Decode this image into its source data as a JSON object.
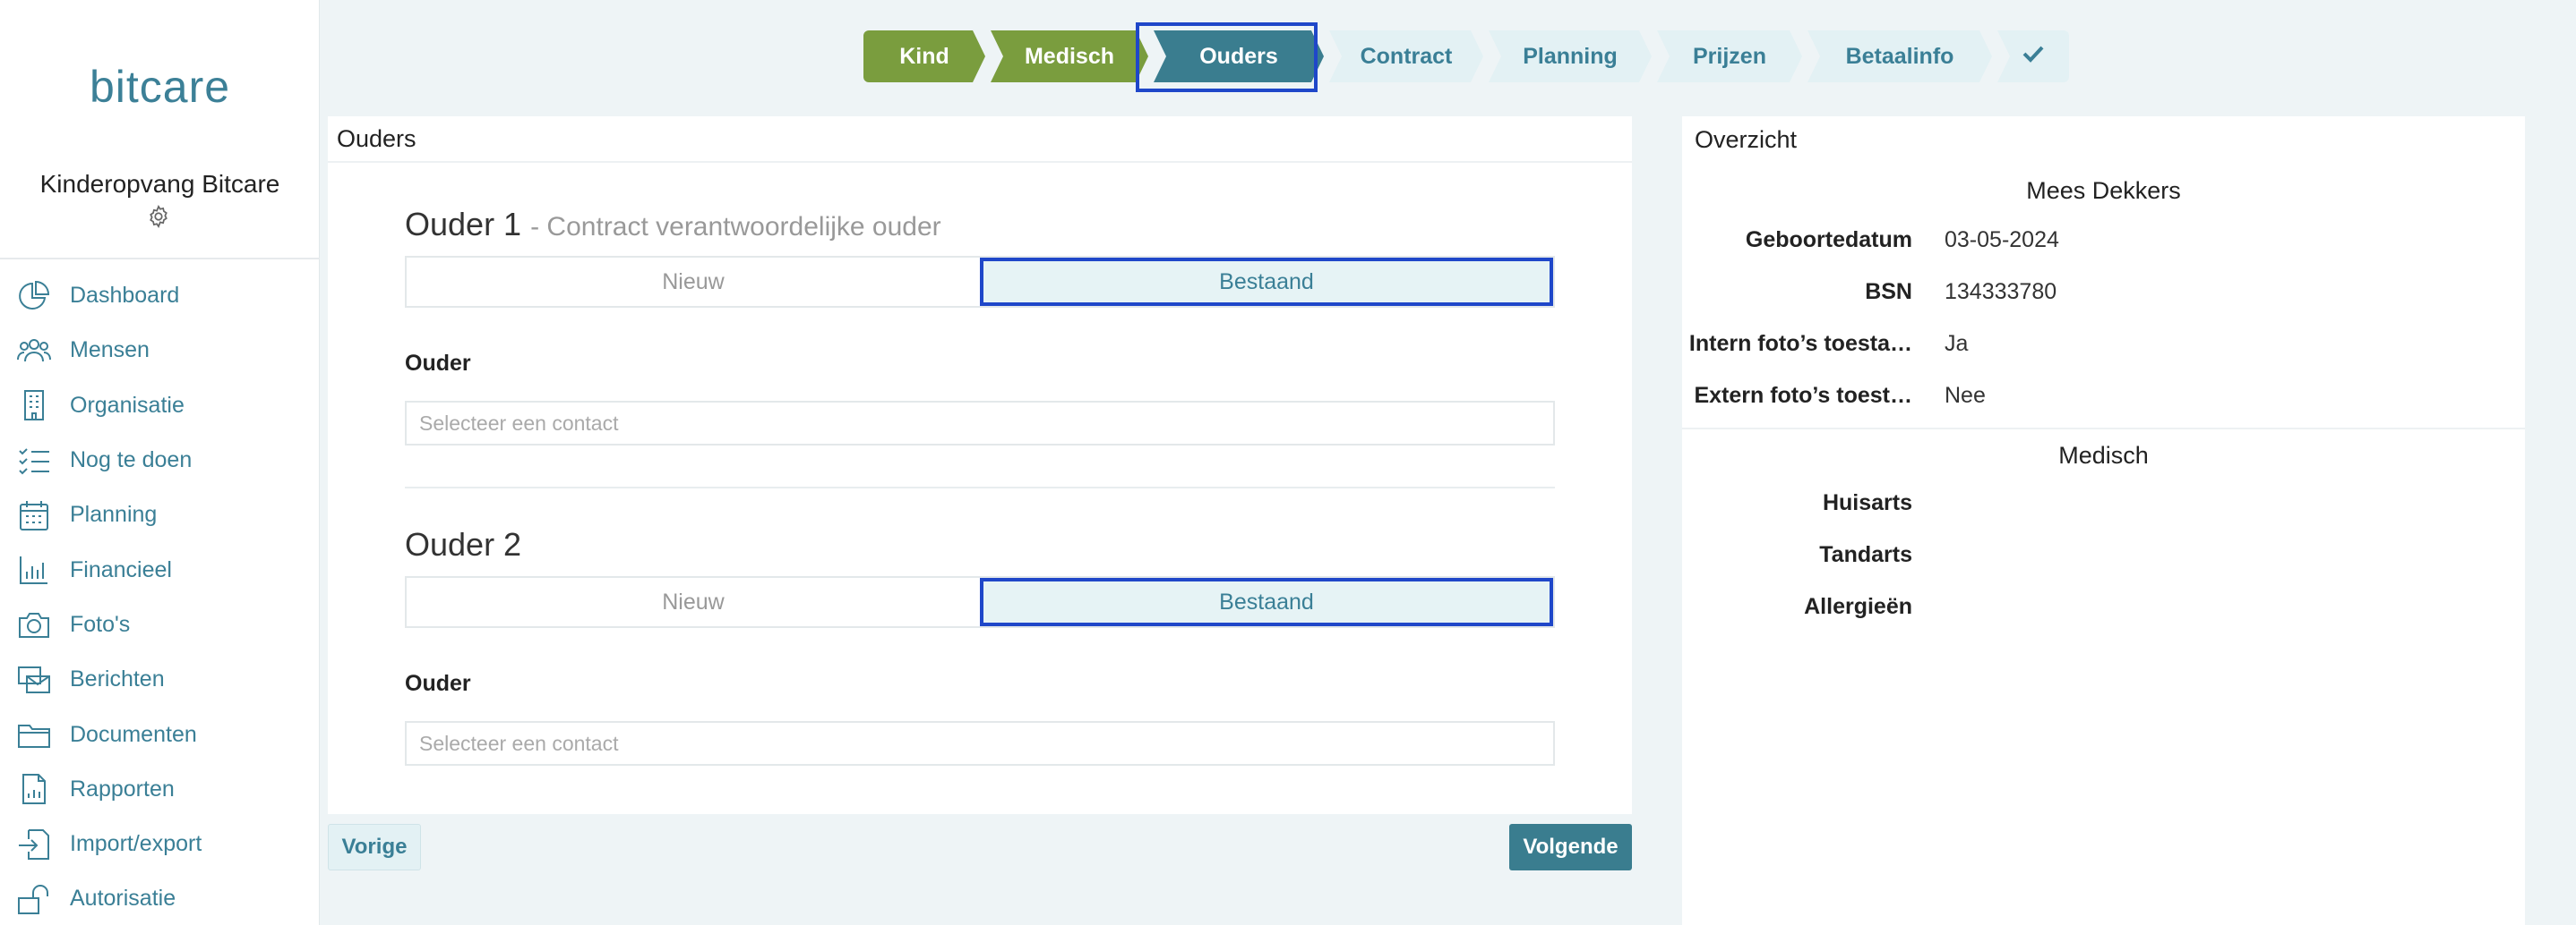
{
  "sidebar": {
    "logo": "bitcare",
    "org_name": "Kinderopvang Bitcare",
    "items": [
      {
        "label": "Dashboard",
        "icon": "pie-chart-icon"
      },
      {
        "label": "Mensen",
        "icon": "people-icon"
      },
      {
        "label": "Organisatie",
        "icon": "building-icon"
      },
      {
        "label": "Nog te doen",
        "icon": "checklist-icon"
      },
      {
        "label": "Planning",
        "icon": "calendar-icon"
      },
      {
        "label": "Financieel",
        "icon": "bar-chart-icon"
      },
      {
        "label": "Foto's",
        "icon": "camera-icon"
      },
      {
        "label": "Berichten",
        "icon": "messages-icon"
      },
      {
        "label": "Documenten",
        "icon": "folder-icon"
      },
      {
        "label": "Rapporten",
        "icon": "report-icon"
      },
      {
        "label": "Import/export",
        "icon": "import-icon"
      },
      {
        "label": "Autorisatie",
        "icon": "unlock-icon"
      }
    ]
  },
  "stepper": {
    "steps": [
      {
        "label": "Kind",
        "state": "done"
      },
      {
        "label": "Medisch",
        "state": "done"
      },
      {
        "label": "Ouders",
        "state": "active"
      },
      {
        "label": "Contract",
        "state": "todo"
      },
      {
        "label": "Planning",
        "state": "todo"
      },
      {
        "label": "Prijzen",
        "state": "todo"
      },
      {
        "label": "Betaalinfo",
        "state": "todo"
      }
    ],
    "final_icon": "checkmark-icon"
  },
  "main": {
    "header": "Ouders",
    "parent1": {
      "title": "Ouder 1",
      "subtitle": "- Contract verantwoordelijke ouder",
      "option_new": "Nieuw",
      "option_existing": "Bestaand",
      "field_label": "Ouder",
      "select_placeholder": "Selecteer een contact"
    },
    "parent2": {
      "title": "Ouder 2",
      "option_new": "Nieuw",
      "option_existing": "Bestaand",
      "field_label": "Ouder",
      "select_placeholder": "Selecteer een contact"
    },
    "prev_label": "Vorige",
    "next_label": "Volgende"
  },
  "overview": {
    "header": "Overzicht",
    "child_name": "Mees Dekkers",
    "rows": [
      {
        "key": "Geboortedatum",
        "value": "03-05-2024"
      },
      {
        "key": "BSN",
        "value": "134333780"
      },
      {
        "key": "Intern foto’s toesta…",
        "value": "Ja"
      },
      {
        "key": "Extern foto’s toest…",
        "value": "Nee"
      }
    ],
    "medical_title": "Medisch",
    "medical_rows": [
      {
        "key": "Huisarts",
        "value": ""
      },
      {
        "key": "Tandarts",
        "value": ""
      },
      {
        "key": "Allergieën",
        "value": ""
      }
    ]
  },
  "colors": {
    "accent": "#3a7f96",
    "done": "#7a9d3e",
    "active": "#3a7d8f",
    "focus": "#1f47c9"
  }
}
